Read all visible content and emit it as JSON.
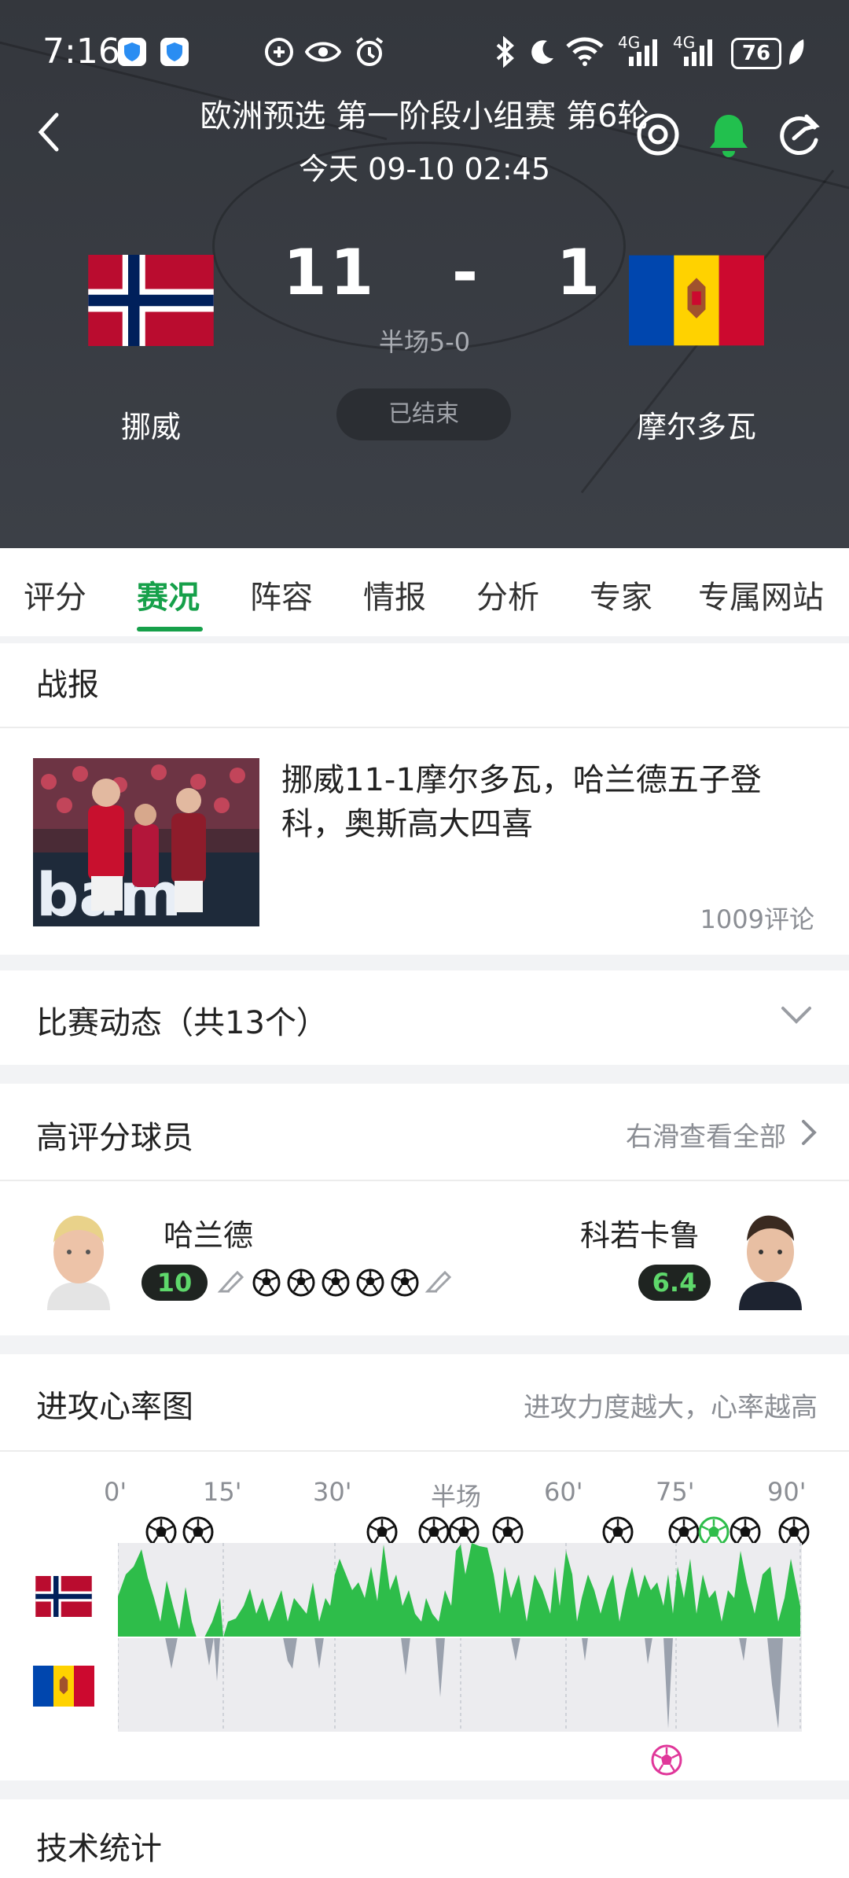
{
  "status_bar": {
    "time": "7:16",
    "battery": "76",
    "network_1": "4G",
    "network_2": "4G",
    "icons": [
      "shield-icon",
      "shield-icon",
      "vpn-icon",
      "eye-icon",
      "alarm-icon",
      "bluetooth-icon",
      "moon-icon",
      "wifi-icon",
      "signal-icon",
      "signal-icon",
      "battery-icon",
      "leaf-icon"
    ]
  },
  "match": {
    "competition": "欧洲预选 第一阶段小组赛 第6轮",
    "datetime": "今天 09-10 02:45",
    "home_team": "挪威",
    "away_team": "摩尔多瓦",
    "score": "11   -   1",
    "half_time": "半场5-0",
    "status": "已结束"
  },
  "tabs": [
    {
      "label": "评分"
    },
    {
      "label": "赛况"
    },
    {
      "label": "阵容"
    },
    {
      "label": "情报"
    },
    {
      "label": "分析"
    },
    {
      "label": "专家"
    },
    {
      "label": "专属网站"
    }
  ],
  "report": {
    "section_title": "战报",
    "headline_line1": "挪威11-1摩尔多瓦，哈兰德五子登",
    "headline_line2": "科，奥斯高大四喜",
    "comments": "1009评论"
  },
  "events": {
    "title": "比赛动态（共13个）"
  },
  "top_players": {
    "title": "高评分球员",
    "view_all": "右滑查看全部",
    "home_player": {
      "name": "哈兰德",
      "rating": "10",
      "goals": 5,
      "assists": 2
    },
    "away_player": {
      "name": "科若卡鲁",
      "rating": "6.4"
    }
  },
  "momentum": {
    "title": "进攻心率图",
    "hint": "进攻力度越大，心率越高",
    "minute_labels": [
      "0'",
      "15'",
      "30'",
      "半场",
      "60'",
      "75'",
      "90'"
    ],
    "home_color": "#2ebd4a",
    "away_color": "#9aa1ad"
  },
  "stats": {
    "title": "技术统计"
  },
  "colors": {
    "accent": "#16a04a",
    "header_bg": "#383b41",
    "rating_text": "#5ed86b"
  }
}
